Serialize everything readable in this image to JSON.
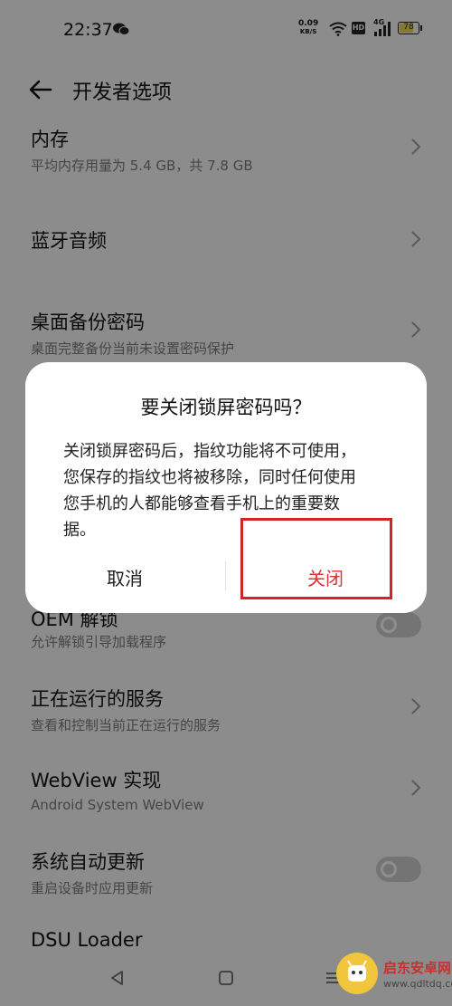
{
  "status_bar": {
    "time": "22:37",
    "net_speed_value": "0.09",
    "net_speed_unit": "KB/S",
    "hd_label": "HD",
    "network_label": "4G",
    "battery_level": "78"
  },
  "app_bar": {
    "title": "开发者选项"
  },
  "settings": {
    "memory": {
      "title": "内存",
      "subtitle": "平均内存用量为 5.4 GB，共 7.8 GB"
    },
    "bluetooth_audio": {
      "title": "蓝牙音频"
    },
    "desktop_backup_password": {
      "title": "桌面备份密码",
      "subtitle": "桌面完整备份当前未设置密码保护"
    },
    "oem_unlock": {
      "title": "OEM 解锁",
      "subtitle": "允许解锁引导加载程序"
    },
    "running_services": {
      "title": "正在运行的服务",
      "subtitle": "查看和控制当前正在运行的服务"
    },
    "webview": {
      "title": "WebView 实现",
      "subtitle": "Android System WebView"
    },
    "auto_update": {
      "title": "系统自动更新",
      "subtitle": "重启设备时应用更新"
    },
    "dsu_loader": {
      "title": "DSU Loader"
    }
  },
  "dialog": {
    "title": "要关闭锁屏密码吗？",
    "message_lines": [
      "关闭锁屏密码后，指纹功能将不可使用，",
      "您保存的指纹也将被移除，同时任何使用",
      "您手机的人都能够查看手机上的重要数",
      "据。"
    ],
    "cancel_label": "取消",
    "confirm_label": "关闭"
  },
  "watermark": {
    "name": "启东安卓网",
    "url": "www.qdltdq.com"
  },
  "colors": {
    "accent_red": "#d42428",
    "confirm_text": "#dd3333",
    "background": "#f2f2f2"
  }
}
